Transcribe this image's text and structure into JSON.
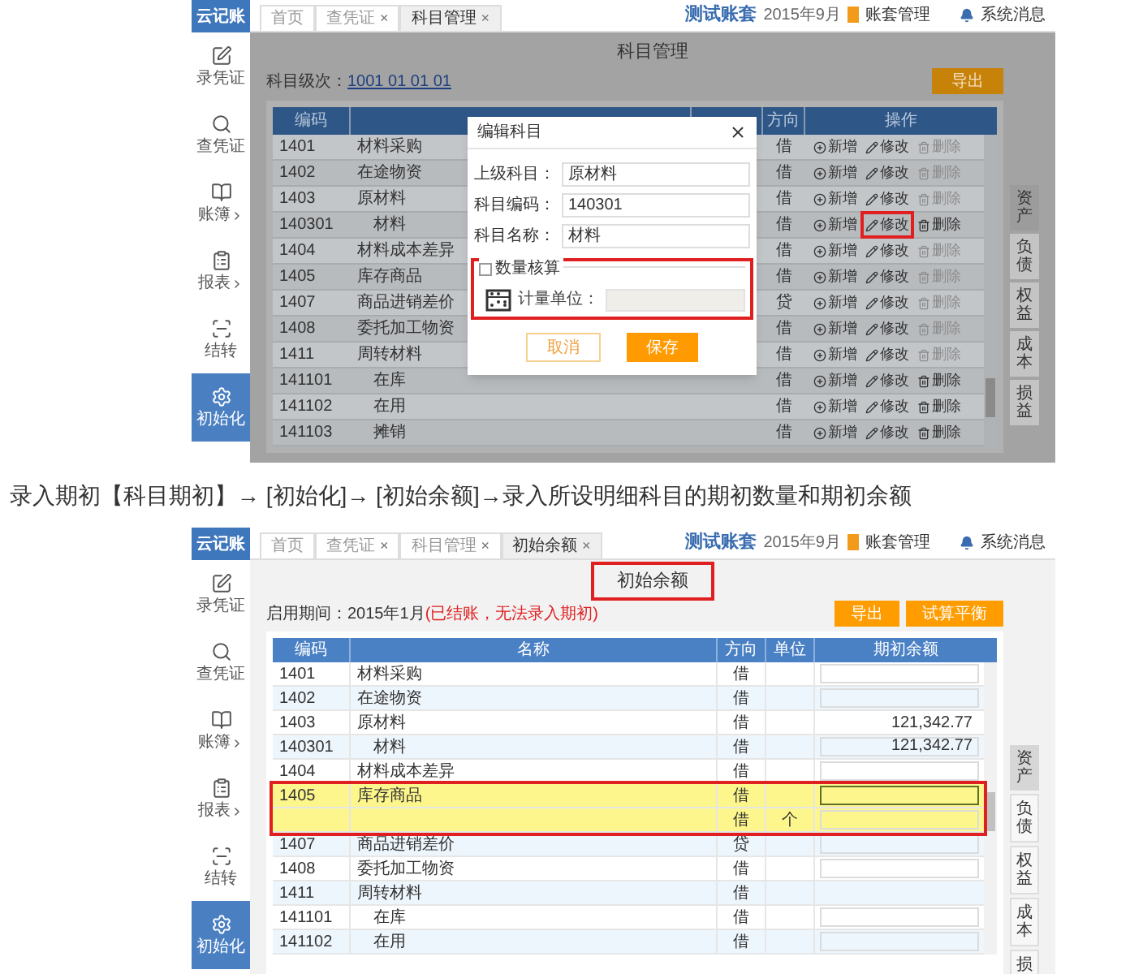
{
  "screens": [
    {
      "kind": "subjects",
      "logo": "云记账",
      "header": {
        "account": "测试账套",
        "period": "2015年9月",
        "manage": "账套管理",
        "messages": "系统消息"
      },
      "sidebar": [
        {
          "label": "录凭证",
          "selected": false,
          "expandable": false
        },
        {
          "label": "查凭证",
          "selected": false,
          "expandable": false
        },
        {
          "label": "账簿",
          "selected": false,
          "expandable": true
        },
        {
          "label": "报表",
          "selected": false,
          "expandable": true
        },
        {
          "label": "结转",
          "selected": false,
          "expandable": false
        },
        {
          "label": "初始化",
          "selected": true,
          "expandable": false
        }
      ],
      "tabs": [
        {
          "label": "首页",
          "selected": false
        },
        {
          "label": "查凭证",
          "close": "×",
          "selected": false
        },
        {
          "label": "科目管理",
          "close": "×",
          "selected": true
        }
      ],
      "title": "科目管理",
      "title_marked": false,
      "buttons": [
        {
          "label": "导出"
        }
      ],
      "levels_label": "科目级次：",
      "levels_value": "1001 01 01 01",
      "columns": {
        "code": "编码",
        "direction": "方向",
        "actions": "操作"
      },
      "rows": [
        {
          "code": "1401",
          "name": "材料采购",
          "direction": "借",
          "actions": [
            {
              "kind": "add",
              "label": "新增"
            },
            {
              "kind": "edit",
              "label": "修改",
              "marked": false
            },
            {
              "kind": "delete",
              "label": "删除",
              "disabled": true
            }
          ]
        },
        {
          "code": "1402",
          "name": "在途物资",
          "direction": "借",
          "actions": [
            {
              "kind": "add",
              "label": "新增"
            },
            {
              "kind": "edit",
              "label": "修改",
              "marked": false
            },
            {
              "kind": "delete",
              "label": "删除",
              "disabled": true
            }
          ]
        },
        {
          "code": "1403",
          "name": "原材料",
          "direction": "借",
          "actions": [
            {
              "kind": "add",
              "label": "新增"
            },
            {
              "kind": "edit",
              "label": "修改",
              "marked": false
            },
            {
              "kind": "delete",
              "label": "删除",
              "disabled": true
            }
          ],
          "children": [
            {
              "code": "140301",
              "name": "材料",
              "direction": "借",
              "actions": [
                {
                  "kind": "add",
                  "label": "新增"
                },
                {
                  "kind": "edit",
                  "label": "修改",
                  "marked": true
                },
                {
                  "kind": "delete",
                  "label": "删除",
                  "disabled": false
                }
              ]
            }
          ]
        },
        {
          "code": "1404",
          "name": "材料成本差异",
          "direction": "借",
          "actions": [
            {
              "kind": "add",
              "label": "新增"
            },
            {
              "kind": "edit",
              "label": "修改",
              "marked": false
            },
            {
              "kind": "delete",
              "label": "删除",
              "disabled": true
            }
          ]
        },
        {
          "code": "1405",
          "name": "库存商品",
          "direction": "借",
          "actions": [
            {
              "kind": "add",
              "label": "新增"
            },
            {
              "kind": "edit",
              "label": "修改",
              "marked": false
            },
            {
              "kind": "delete",
              "label": "删除",
              "disabled": true
            }
          ]
        },
        {
          "code": "1407",
          "name": "商品进销差价",
          "direction": "贷",
          "actions": [
            {
              "kind": "add",
              "label": "新增"
            },
            {
              "kind": "edit",
              "label": "修改",
              "marked": false
            },
            {
              "kind": "delete",
              "label": "删除",
              "disabled": true
            }
          ]
        },
        {
          "code": "1408",
          "name": "委托加工物资",
          "direction": "借",
          "actions": [
            {
              "kind": "add",
              "label": "新增"
            },
            {
              "kind": "edit",
              "label": "修改",
              "marked": false
            },
            {
              "kind": "delete",
              "label": "删除",
              "disabled": true
            }
          ]
        },
        {
          "code": "1411",
          "name": "周转材料",
          "direction": "借",
          "actions": [
            {
              "kind": "add",
              "label": "新增"
            },
            {
              "kind": "edit",
              "label": "修改",
              "marked": false
            },
            {
              "kind": "delete",
              "label": "删除",
              "disabled": true
            }
          ],
          "children": [
            {
              "code": "141101",
              "name": "在库",
              "direction": "借",
              "actions": [
                {
                  "kind": "add",
                  "label": "新增"
                },
                {
                  "kind": "edit",
                  "label": "修改",
                  "marked": false
                },
                {
                  "kind": "delete",
                  "label": "删除",
                  "disabled": false
                }
              ]
            },
            {
              "code": "141102",
              "name": "在用",
              "direction": "借",
              "actions": [
                {
                  "kind": "add",
                  "label": "新增"
                },
                {
                  "kind": "edit",
                  "label": "修改",
                  "marked": false
                },
                {
                  "kind": "delete",
                  "label": "删除",
                  "disabled": false
                }
              ]
            },
            {
              "code": "141103",
              "name": "摊销",
              "direction": "借",
              "actions": [
                {
                  "kind": "add",
                  "label": "新增"
                },
                {
                  "kind": "edit",
                  "label": "修改",
                  "marked": false
                },
                {
                  "kind": "delete",
                  "label": "删除",
                  "disabled": false
                }
              ]
            }
          ]
        }
      ],
      "dialog": {
        "title": "编辑科目",
        "fields": [
          {
            "label": "上级科目：",
            "value": "原材料"
          },
          {
            "label": "科目编码：",
            "value": "140301"
          },
          {
            "label": "科目名称：",
            "value": "材料"
          }
        ],
        "quantity": {
          "label": "数量核算",
          "checked": false,
          "marked": true,
          "unit_label": "计量单位：",
          "unit_disabled": true
        },
        "buttons": [
          {
            "label": "取消",
            "kind": "secondary"
          },
          {
            "label": "保存",
            "kind": "primary"
          }
        ]
      },
      "side_tabs": [
        {
          "label": "资产",
          "selected": true
        },
        {
          "label": "负债",
          "selected": false
        },
        {
          "label": "权益",
          "selected": false
        },
        {
          "label": "成本",
          "selected": false
        },
        {
          "label": "损益",
          "selected": false
        }
      ]
    },
    {
      "kind": "caption",
      "text": "录入期初【科目期初】→ [初始化]→ [初始余额]→录入所设明细科目的期初数量和期初余额"
    },
    {
      "kind": "balances",
      "logo": "云记账",
      "header": {
        "account": "测试账套",
        "period": "2015年9月",
        "manage": "账套管理",
        "messages": "系统消息"
      },
      "sidebar": [
        {
          "label": "录凭证",
          "selected": false,
          "expandable": false
        },
        {
          "label": "查凭证",
          "selected": false,
          "expandable": false
        },
        {
          "label": "账簿",
          "selected": false,
          "expandable": true
        },
        {
          "label": "报表",
          "selected": false,
          "expandable": true
        },
        {
          "label": "结转",
          "selected": false,
          "expandable": false
        },
        {
          "label": "初始化",
          "selected": true,
          "expandable": false
        }
      ],
      "tabs": [
        {
          "label": "首页",
          "selected": false
        },
        {
          "label": "查凭证",
          "close": "×",
          "selected": false
        },
        {
          "label": "科目管理",
          "close": "×",
          "selected": false
        },
        {
          "label": "初始余额",
          "close": "×",
          "selected": true
        }
      ],
      "title": "初始余额",
      "title_marked": true,
      "buttons": [
        {
          "label": "导出"
        },
        {
          "label": "试算平衡"
        }
      ],
      "period_label": "启用期间：2015年1月",
      "period_note": "(已结账，无法录入期初)",
      "columns": {
        "code": "编码",
        "name": "名称",
        "direction": "方向",
        "unit": "单位",
        "balance": "期初余额"
      },
      "rows": [
        {
          "code": "1401",
          "name": "材料采购",
          "direction": "借",
          "input": true,
          "focused": false,
          "highlighted": false
        },
        {
          "code": "1402",
          "name": "在途物资",
          "direction": "借",
          "input": true,
          "focused": false,
          "highlighted": false
        },
        {
          "code": "1403",
          "name": "原材料",
          "direction": "借",
          "balance": "121,342.77",
          "input": false,
          "highlighted": false,
          "children": [
            {
              "code": "140301",
              "name": "材料",
              "direction": "借",
              "balance": "121,342.77",
              "input": true,
              "focused": false,
              "highlighted": false
            }
          ]
        },
        {
          "code": "1404",
          "name": "材料成本差异",
          "direction": "借",
          "input": true,
          "focused": false,
          "highlighted": false
        },
        {
          "code": "1405",
          "name": "库存商品",
          "direction": "借",
          "input": true,
          "focused": true,
          "highlighted": true,
          "children": [
            {
              "direction": "借",
              "unit": "个",
              "input": true,
              "focused": false,
              "highlighted": true
            }
          ]
        },
        {
          "code": "1407",
          "name": "商品进销差价",
          "direction": "贷",
          "input": true,
          "focused": false,
          "highlighted": false
        },
        {
          "code": "1408",
          "name": "委托加工物资",
          "direction": "借",
          "input": true,
          "focused": false,
          "highlighted": false
        },
        {
          "code": "1411",
          "name": "周转材料",
          "direction": "借",
          "input": false,
          "highlighted": false,
          "children": [
            {
              "code": "141101",
              "name": "在库",
              "direction": "借",
              "input": true,
              "focused": false,
              "highlighted": false
            },
            {
              "code": "141102",
              "name": "在用",
              "direction": "借",
              "input": true,
              "focused": false,
              "highlighted": false
            }
          ]
        }
      ],
      "side_tabs": [
        {
          "label": "资产",
          "selected": true
        },
        {
          "label": "负债",
          "selected": false
        },
        {
          "label": "权益",
          "selected": false
        },
        {
          "label": "成本",
          "selected": false
        },
        {
          "label": "损",
          "selected": false
        }
      ]
    }
  ]
}
